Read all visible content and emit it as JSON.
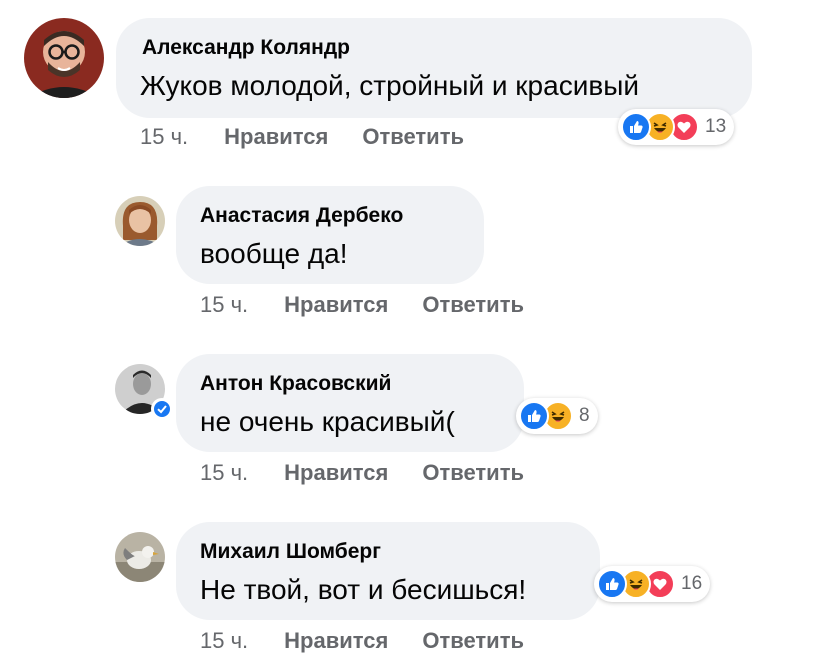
{
  "comments": [
    {
      "author": "Александр Коляндр",
      "text": "Жуков молодой, стройный и красивый",
      "time": "15 ч.",
      "like_label": "Нравится",
      "reply_label": "Ответить",
      "reactions": [
        "like",
        "haha",
        "love"
      ],
      "reaction_count": "13"
    },
    {
      "author": "Анастасия Дербеко",
      "text": "вообще да!",
      "time": "15 ч.",
      "like_label": "Нравится",
      "reply_label": "Ответить"
    },
    {
      "author": "Антон Красовский",
      "text": "не очень красивый(",
      "time": "15 ч.",
      "like_label": "Нравится",
      "reply_label": "Ответить",
      "reactions": [
        "like",
        "haha"
      ],
      "reaction_count": "8",
      "verified": true
    },
    {
      "author": "Михаил Шомберг",
      "text": "Не твой, вот и бесишься!",
      "time": "15 ч.",
      "like_label": "Нравится",
      "reply_label": "Ответить",
      "reactions": [
        "like",
        "haha",
        "love"
      ],
      "reaction_count": "16"
    }
  ],
  "colors": {
    "bubble": "#f0f2f5",
    "meta_text": "#65676b",
    "like": "#1877f2",
    "haha": "#f7b125",
    "love": "#f33e58",
    "verified": "#1877f2"
  }
}
